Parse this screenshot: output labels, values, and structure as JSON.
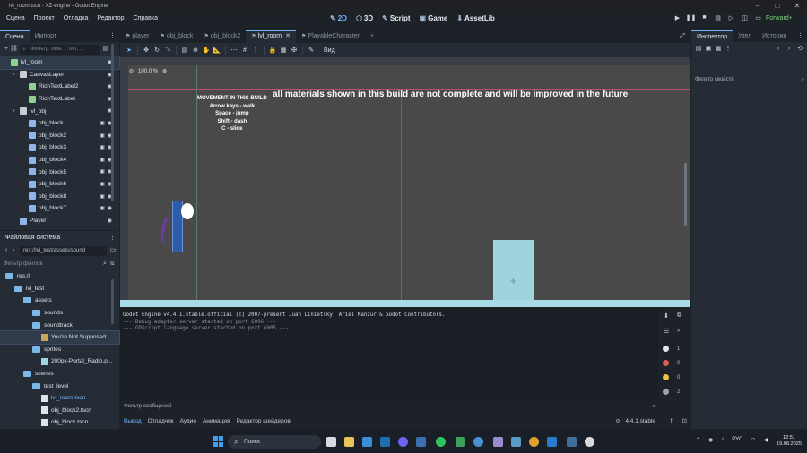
{
  "window": {
    "title": "lvl_room.tscn - XZ-engine - Godot Engine"
  },
  "menu": [
    "Сцена",
    "Проект",
    "Отладка",
    "Редактор",
    "Справка"
  ],
  "workspaces": [
    {
      "label": "2D",
      "icon": "2d-icon",
      "active": true
    },
    {
      "label": "3D",
      "icon": "3d-icon"
    },
    {
      "label": "Script",
      "icon": "script-icon"
    },
    {
      "label": "Game",
      "icon": "game-icon"
    },
    {
      "label": "AssetLib",
      "icon": "assetlib-icon"
    }
  ],
  "renderer": "Forward+",
  "scene_dock": {
    "tabs": [
      "Сцена",
      "Импорт"
    ],
    "filter_placeholder": "Фильтр: имя, т:тип, ...",
    "nodes": [
      {
        "label": "lvl_room",
        "depth": 0,
        "icon_color": "#8fd18f",
        "selected": true
      },
      {
        "label": "CanvasLayer",
        "depth": 1,
        "icon_color": "#c8ccd2"
      },
      {
        "label": "RichTextLabel2",
        "depth": 2,
        "icon_color": "#8fd18f"
      },
      {
        "label": "RichTextLabel",
        "depth": 2,
        "icon_color": "#8fd18f"
      },
      {
        "label": "lvl_obj",
        "depth": 1,
        "icon_color": "#c8ccd2"
      },
      {
        "label": "obj_block",
        "depth": 2,
        "icon_color": "#8fb6ea"
      },
      {
        "label": "obj_block2",
        "depth": 2,
        "icon_color": "#8fb6ea"
      },
      {
        "label": "obj_block3",
        "depth": 2,
        "icon_color": "#8fb6ea"
      },
      {
        "label": "obj_block4",
        "depth": 2,
        "icon_color": "#8fb6ea"
      },
      {
        "label": "obj_block5",
        "depth": 2,
        "icon_color": "#8fb6ea"
      },
      {
        "label": "obj_block6",
        "depth": 2,
        "icon_color": "#8fb6ea"
      },
      {
        "label": "obj_block8",
        "depth": 2,
        "icon_color": "#8fb6ea"
      },
      {
        "label": "obj_block7",
        "depth": 2,
        "icon_color": "#8fb6ea"
      },
      {
        "label": "Player",
        "depth": 1,
        "icon_color": "#8fb6ea"
      }
    ]
  },
  "fs_dock": {
    "title": "Файловая система",
    "path": "res://lvl_test/assets/sound",
    "filter_placeholder": "Фильтр файлов",
    "items": [
      {
        "label": "res://",
        "depth": 0,
        "kind": "folder"
      },
      {
        "label": "lvl_test",
        "depth": 1,
        "kind": "folder"
      },
      {
        "label": "assets",
        "depth": 2,
        "kind": "folder"
      },
      {
        "label": "sounds",
        "depth": 3,
        "kind": "folder"
      },
      {
        "label": "soundtrack",
        "depth": 3,
        "kind": "folder"
      },
      {
        "label": "You're Not Supposed ...",
        "depth": 4,
        "kind": "file",
        "selected": true
      },
      {
        "label": "sprites",
        "depth": 3,
        "kind": "folder"
      },
      {
        "label": "200px-Portal_Radio.p...",
        "depth": 4,
        "kind": "image"
      },
      {
        "label": "scenes",
        "depth": 2,
        "kind": "folder"
      },
      {
        "label": "test_level",
        "depth": 3,
        "kind": "folder"
      },
      {
        "label": "lvl_room.tscn",
        "depth": 4,
        "kind": "scene",
        "highlight": true
      },
      {
        "label": "obj_block2.tscn",
        "depth": 4,
        "kind": "scene"
      },
      {
        "label": "obj_block.tscn",
        "depth": 4,
        "kind": "scene"
      }
    ]
  },
  "editor_tabs": [
    {
      "label": "player",
      "active": false
    },
    {
      "label": "obj_block",
      "active": false
    },
    {
      "label": "obj_block2",
      "active": false
    },
    {
      "label": "lvl_room",
      "active": true
    },
    {
      "label": "PlayableCharacter",
      "active": false
    }
  ],
  "toolbar2d": {
    "view_label": "Вид"
  },
  "viewport": {
    "zoom": "100.0 %",
    "movement_title": "MOVEMENT IN THIS BUILD",
    "movement_lines": [
      "Arrow keys - walk",
      "Space - jump",
      "Shift - dash",
      "C - slide"
    ],
    "banner": "all materials shown in this build are not complete and will be improved in the future"
  },
  "output": {
    "lines": [
      "Godot Engine v4.4.1.stable.official (c) 2007-present Juan Linietsky, Ariel Manzur & Godot Contributors.",
      "--- Debug adapter server started on port 6006 ---",
      "--- GDScript language server started on port 6005 ---"
    ],
    "filter_placeholder": "Фильтр сообщений",
    "counts": [
      {
        "icon": "log-icon",
        "value": "1",
        "color": "#e0e4ea"
      },
      {
        "icon": "error-icon",
        "value": "0",
        "color": "#e55a5a"
      },
      {
        "icon": "warning-icon",
        "value": "0",
        "color": "#f0c040"
      },
      {
        "icon": "info-icon",
        "value": "2",
        "color": "#e0e4ea"
      }
    ]
  },
  "bottom_tabs": [
    "Вывод",
    "Отладчик",
    "Аудио",
    "Анимация",
    "Редактор шейдеров"
  ],
  "version": "4.4.1.stable",
  "inspector": {
    "tabs": [
      "Инспектор",
      "Узел",
      "История"
    ],
    "filter_placeholder": "Фильтр свойств"
  },
  "taskbar": {
    "search": "Поиск",
    "lang": "РУС",
    "time": "12:51",
    "date": "19.08.2025"
  }
}
